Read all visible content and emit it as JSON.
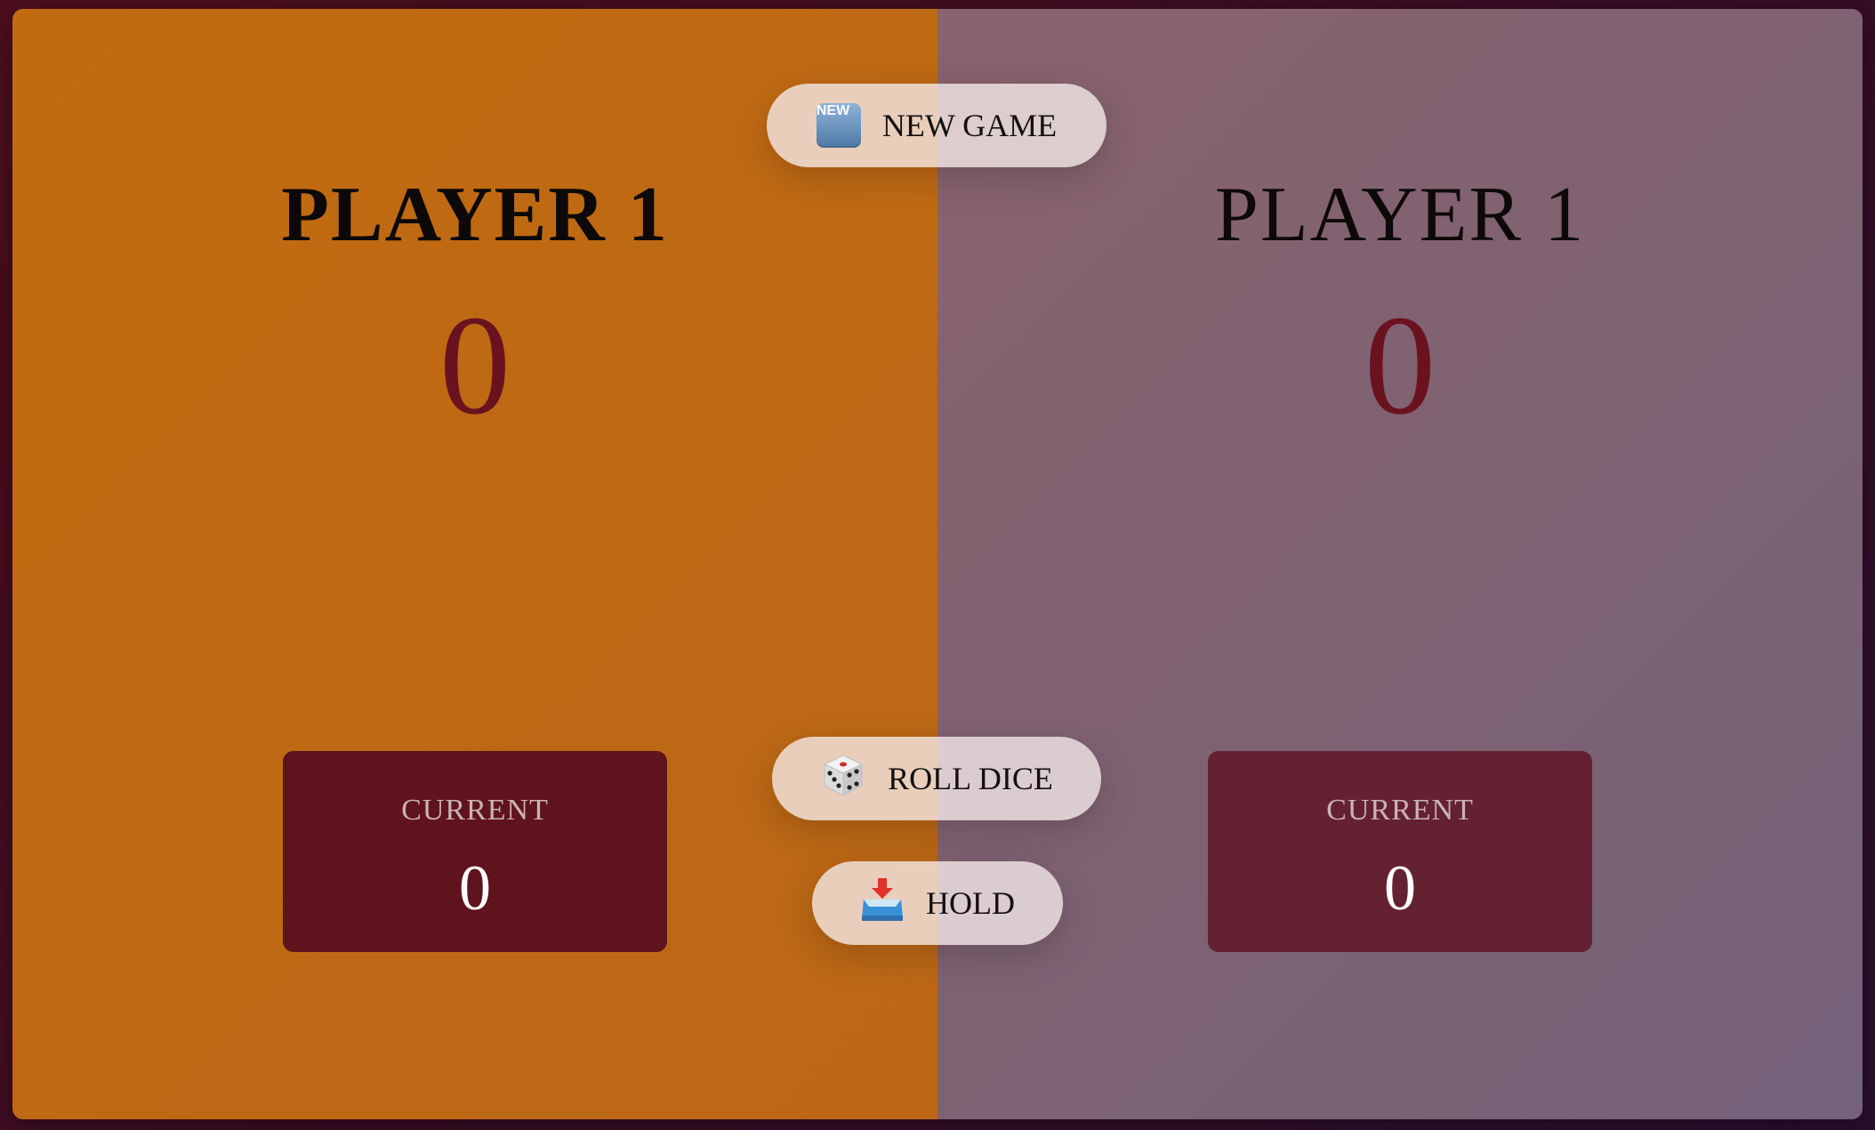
{
  "players": [
    {
      "name": "PLAYER 1",
      "score": "0",
      "current_label": "CURRENT",
      "current_score": "0",
      "active": true
    },
    {
      "name": "PLAYER 1",
      "score": "0",
      "current_label": "CURRENT",
      "current_score": "0",
      "active": false
    }
  ],
  "buttons": {
    "new_game": {
      "label": "NEW GAME",
      "icon": "new-icon",
      "icon_text": "NEW"
    },
    "roll_dice": {
      "label": "ROLL DICE",
      "icon": "dice-icon"
    },
    "hold": {
      "label": "HOLD",
      "icon": "inbox-tray-icon"
    }
  },
  "colors": {
    "active_panel": "#c16b11",
    "inactive_panel": "#7c6273",
    "score": "#6b1220",
    "current_box_active": "#5f131d",
    "current_box_inactive": "#642131"
  }
}
